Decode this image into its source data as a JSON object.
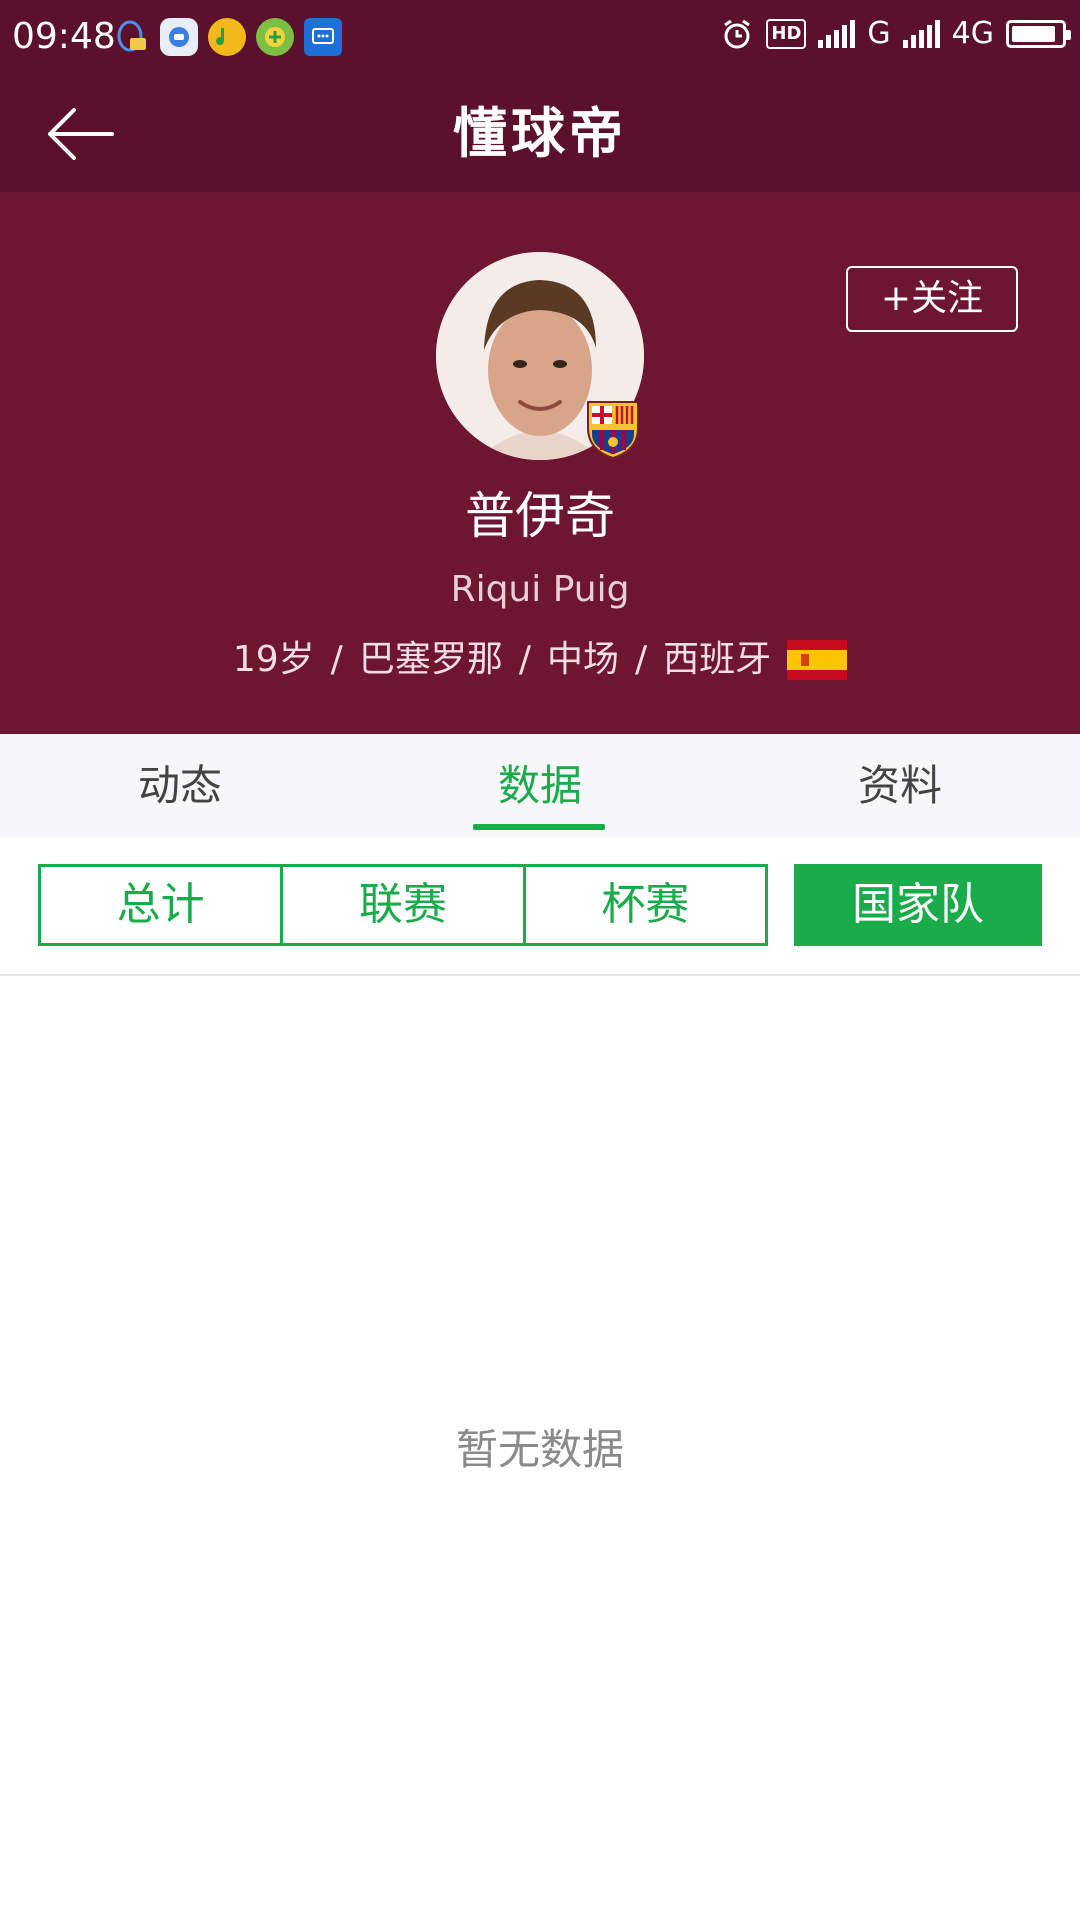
{
  "status_bar": {
    "time": "09:48",
    "hd_label": "HD",
    "network_1": "G",
    "network_2": "4G",
    "battery_level": 0.9
  },
  "app_bar": {
    "title": "懂球帝"
  },
  "player": {
    "name": "普伊奇",
    "name_en": "Riqui Puig",
    "age": "19岁",
    "club": "巴塞罗那",
    "position": "中场",
    "nationality": "西班牙",
    "separator": "/"
  },
  "follow_button": {
    "label": "+关注"
  },
  "tabs": [
    {
      "label": "动态"
    },
    {
      "label": "数据"
    },
    {
      "label": "资料"
    }
  ],
  "filters": [
    {
      "label": "总计"
    },
    {
      "label": "联赛"
    },
    {
      "label": "杯赛"
    },
    {
      "label": "国家队"
    }
  ],
  "empty_state": {
    "message": "暂无数据"
  },
  "colors": {
    "header": "#5b112c",
    "hero": "#6e1531",
    "accent": "#1aab4a"
  },
  "icons": [
    "back-arrow-icon",
    "alarm-icon",
    "signal-icon",
    "battery-icon",
    "barcelona-badge-icon",
    "spain-flag-icon"
  ]
}
